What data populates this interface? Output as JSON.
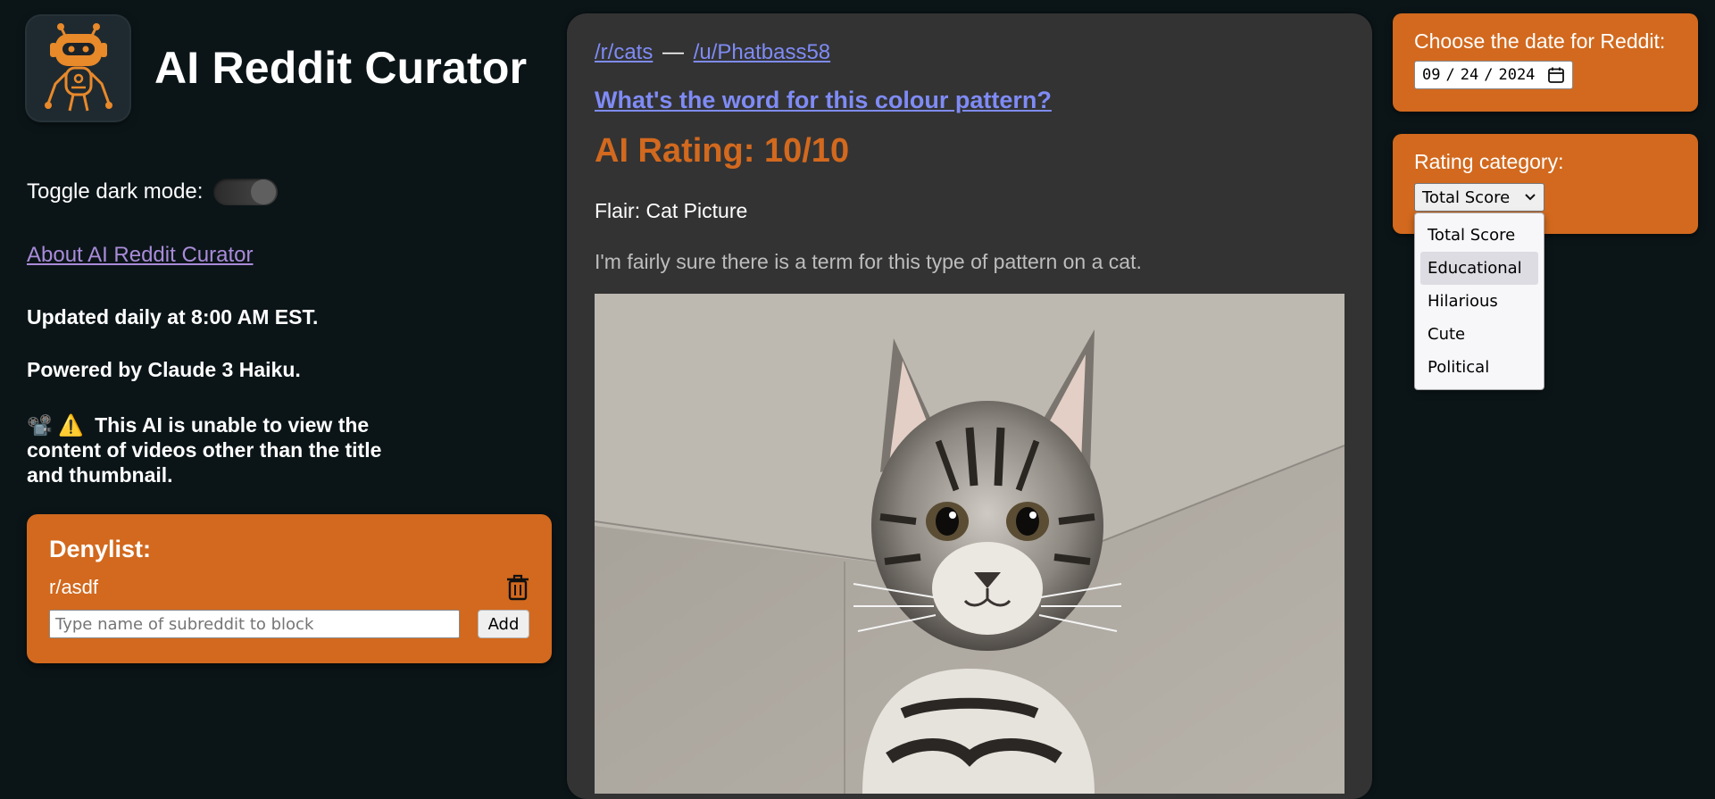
{
  "app": {
    "title": "AI Reddit Curator",
    "dark_mode_label": "Toggle dark mode:",
    "dark_mode_on": true,
    "about_link": "About AI Reddit Curator",
    "update_note": "Updated daily at 8:00 AM EST.",
    "powered_by": "Powered by Claude 3 Haiku.",
    "video_warning_emoji": "📽️ ⚠️",
    "video_warning": "This AI is unable to view the content of videos other than the title and thumbnail."
  },
  "denylist": {
    "title": "Denylist:",
    "items": [
      {
        "name": "r/asdf",
        "icon": "trash-icon"
      }
    ],
    "input_placeholder": "Type name of subreddit to block",
    "input_value": "",
    "add_label": "Add"
  },
  "post": {
    "subreddit": "/r/cats",
    "separator": "—",
    "author": "/u/Phatbass58",
    "title": "What's the word for this colour pattern?",
    "rating": "AI Rating: 10/10",
    "flair": "Flair: Cat Picture",
    "body": "I'm fairly sure there is a term for this type of pattern on a cat."
  },
  "date_picker": {
    "label": "Choose the date for Reddit:",
    "month": "09",
    "day": "24",
    "year": "2024",
    "icon": "calendar-icon"
  },
  "rating_category": {
    "label": "Rating category:",
    "selected": "Total Score",
    "options": [
      "Total Score",
      "Educational",
      "Hilarious",
      "Cute",
      "Political"
    ],
    "hovered_index": 1
  },
  "colors": {
    "background": "#0b1518",
    "accent": "#d2691e",
    "card": "#333333",
    "link": "#7f8bf5",
    "visited_link": "#a98bd9"
  }
}
